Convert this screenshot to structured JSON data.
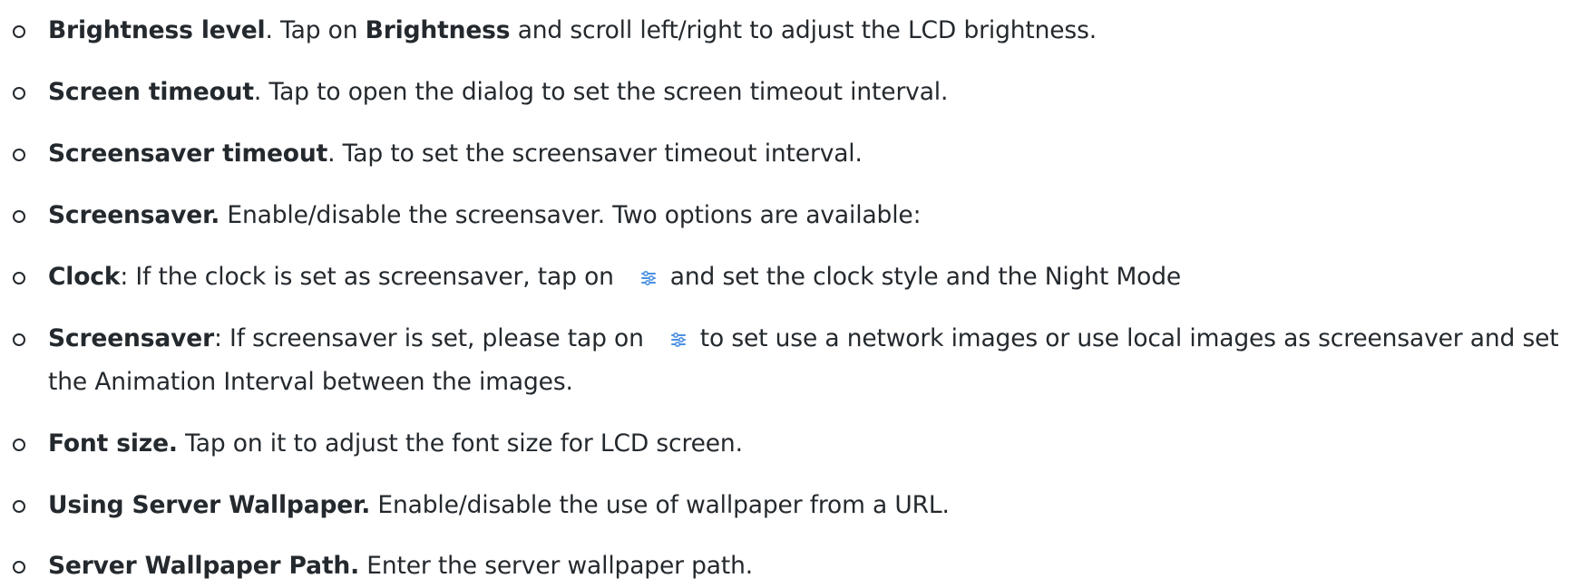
{
  "items": [
    {
      "term": "Brightness level",
      "t1": ". Tap on ",
      "term2": "Brightness",
      "t2": " and scroll left/right to adjust the LCD brightness."
    },
    {
      "term": "Screen timeout",
      "text": ". Tap to open the dialog to set the screen timeout interval."
    },
    {
      "term": "Screensaver timeout",
      "text": ". Tap to set the screensaver timeout interval."
    },
    {
      "term": "Screensaver.",
      "text": " Enable/disable the screensaver. Two options are available:"
    },
    {
      "term": "Clock",
      "before_icon": ": If the clock is set as screensaver, tap on",
      "icon": "settings-sliders-icon",
      "after_icon": "and set the clock style and the Night Mode"
    },
    {
      "term": "Screensaver",
      "before_icon": ": If screensaver is set, please tap on",
      "icon": "settings-sliders-icon",
      "after_icon": "to set use a network images or use local images as screensaver and set the Animation Interval between the images."
    },
    {
      "term": "Font size.",
      "text": " Tap on it to adjust the font size for LCD screen."
    },
    {
      "term": "Using Server Wallpaper.",
      "text": " Enable/disable the use of wallpaper from a URL."
    },
    {
      "term": "Server Wallpaper Path.",
      "text": " Enter the server wallpaper path."
    }
  ],
  "colors": {
    "text": "#24292e",
    "icon": "#4a90e2"
  }
}
